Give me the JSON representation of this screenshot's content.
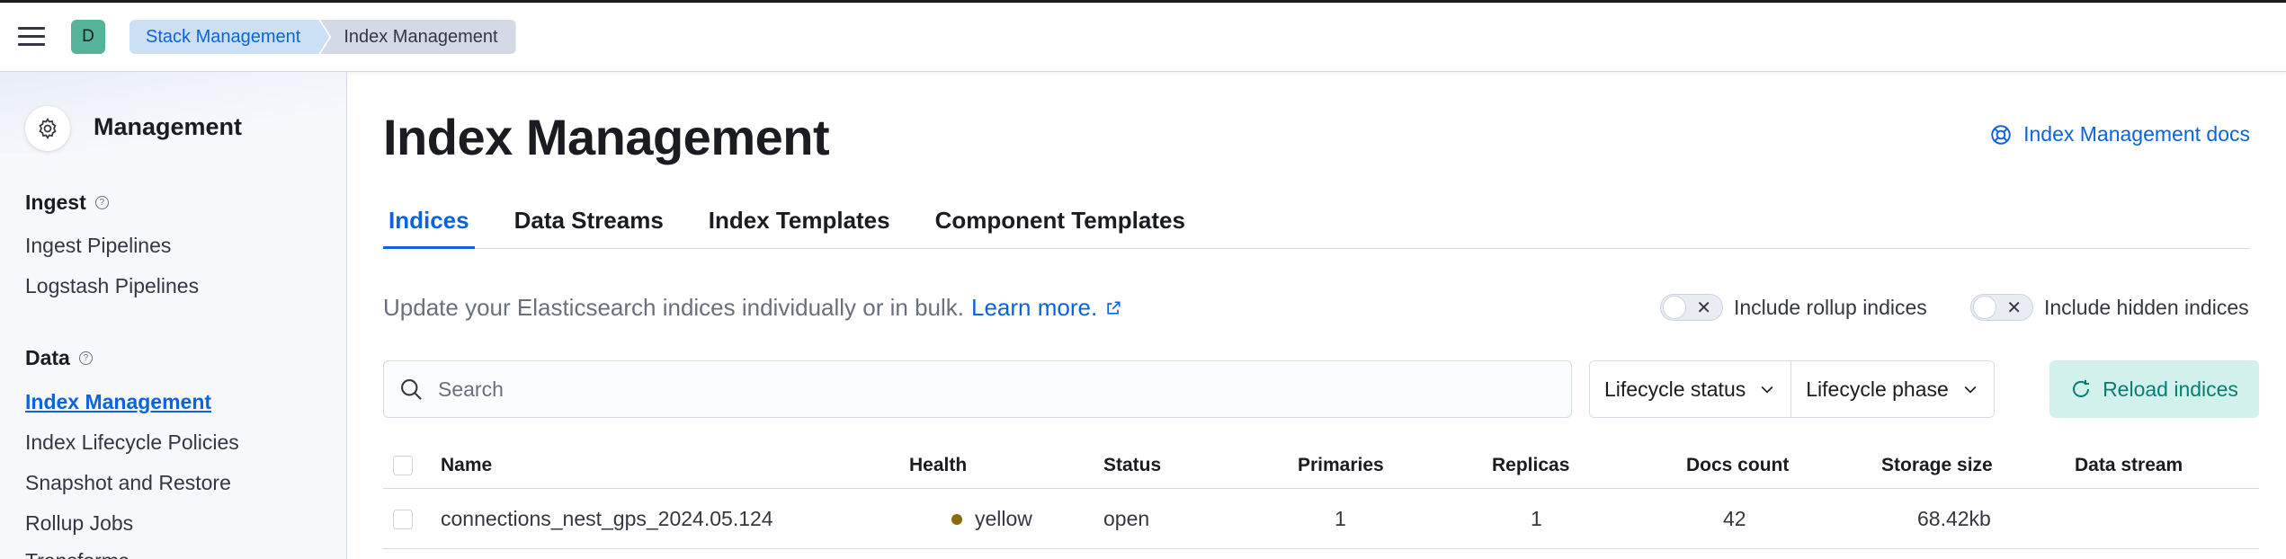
{
  "header": {
    "avatar_letter": "D",
    "breadcrumbs": [
      "Stack Management",
      "Index Management"
    ]
  },
  "sidebar": {
    "title": "Management",
    "sections": [
      {
        "title": "Ingest",
        "items": [
          "Ingest Pipelines",
          "Logstash Pipelines"
        ]
      },
      {
        "title": "Data",
        "items": [
          "Index Management",
          "Index Lifecycle Policies",
          "Snapshot and Restore",
          "Rollup Jobs"
        ]
      }
    ],
    "active_item": "Index Management",
    "partial_item": "Transforms"
  },
  "main": {
    "title": "Index Management",
    "docs_link": "Index Management docs",
    "tabs": [
      "Indices",
      "Data Streams",
      "Index Templates",
      "Component Templates"
    ],
    "active_tab": "Indices",
    "description": "Update your Elasticsearch indices individually or in bulk.",
    "learn_more": "Learn more.",
    "toggles": [
      {
        "label": "Include rollup indices",
        "on": false
      },
      {
        "label": "Include hidden indices",
        "on": false
      }
    ],
    "search": {
      "placeholder": "Search",
      "value": ""
    },
    "filters": [
      "Lifecycle status",
      "Lifecycle phase"
    ],
    "reload_label": "Reload indices"
  },
  "table": {
    "columns": [
      "Name",
      "Health",
      "Status",
      "Primaries",
      "Replicas",
      "Docs count",
      "Storage size",
      "Data stream"
    ],
    "rows": [
      {
        "name": "connections_nest_gps_2024.05.124",
        "health": "yellow",
        "status": "open",
        "primaries": "1",
        "replicas": "1",
        "docs_count": "42",
        "storage_size": "68.42kb",
        "data_stream": ""
      }
    ]
  },
  "colors": {
    "accent": "#0b64dd",
    "health_yellow": "#8a6a0a",
    "reload_bg": "#d2f0ec",
    "avatar_bg": "#54b399"
  }
}
